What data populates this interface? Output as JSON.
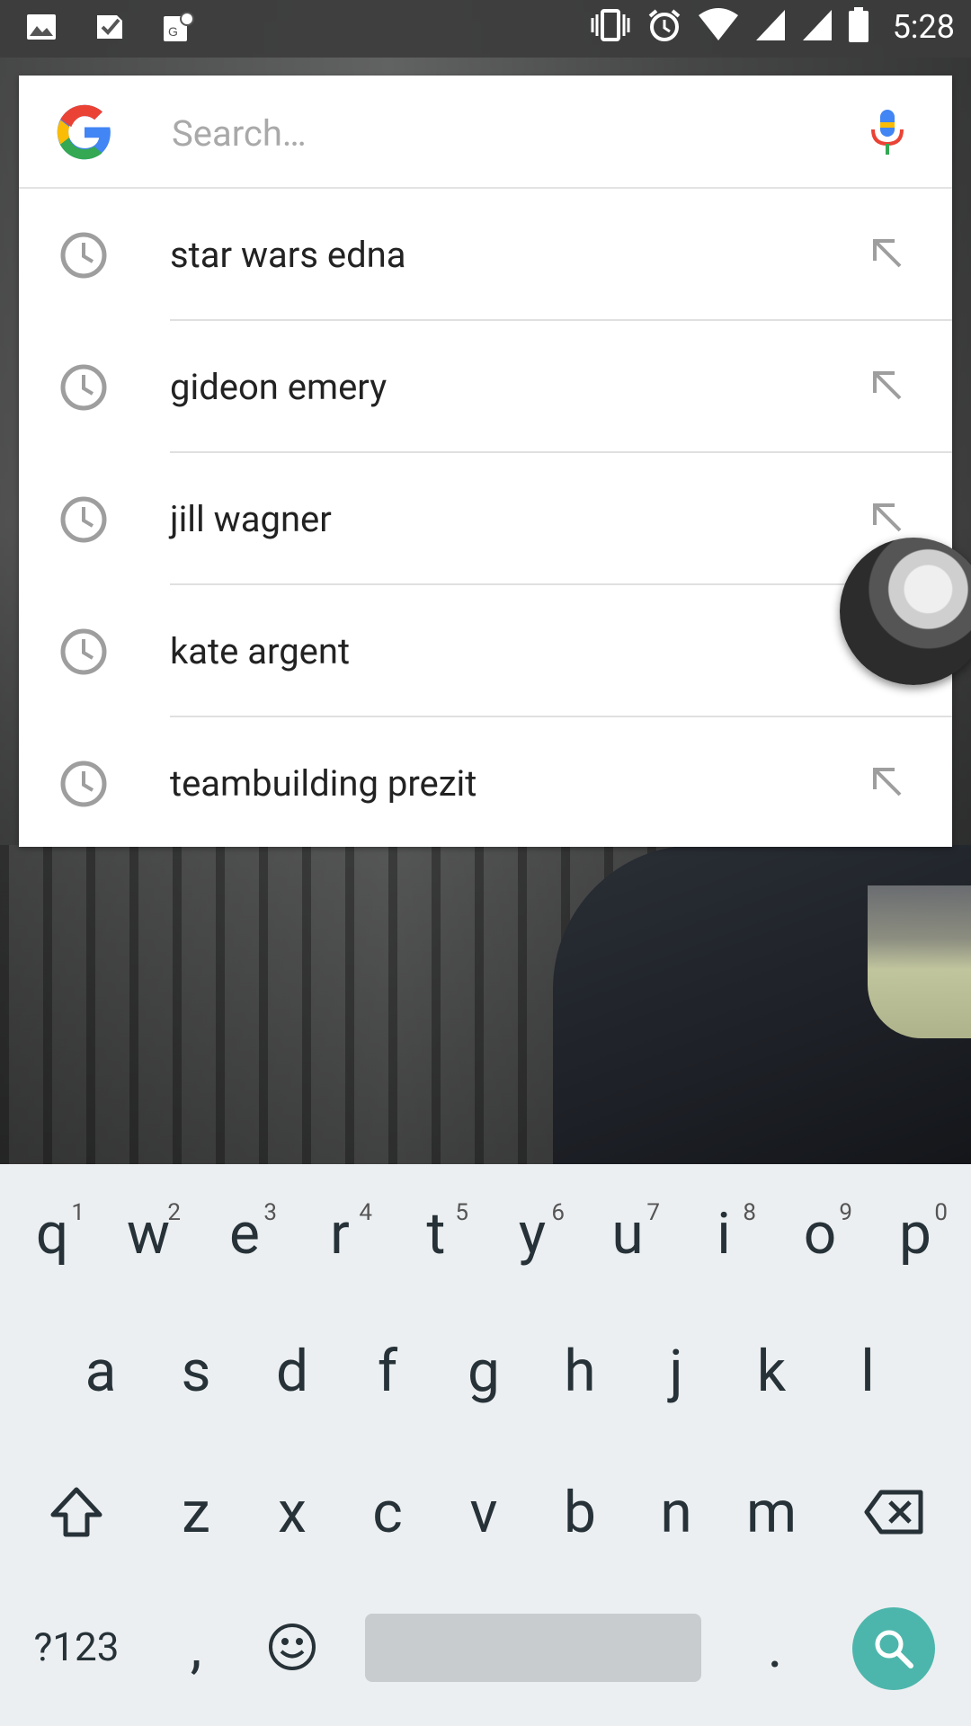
{
  "status_bar": {
    "time": "5:28",
    "left_icons": [
      "image-icon",
      "check-icon",
      "maps-icon"
    ],
    "right_icons": [
      "vibrate-icon",
      "alarm-icon",
      "wifi-icon",
      "signal-icon",
      "signal2-icon",
      "battery-icon"
    ]
  },
  "search": {
    "placeholder": "Search…",
    "value": ""
  },
  "suggestions": [
    {
      "label": "star wars edna"
    },
    {
      "label": "gideon emery"
    },
    {
      "label": "jill wagner"
    },
    {
      "label": "kate argent"
    },
    {
      "label": "teambuilding prezit"
    }
  ],
  "keyboard": {
    "row1": [
      {
        "key": "q",
        "hint": "1"
      },
      {
        "key": "w",
        "hint": "2"
      },
      {
        "key": "e",
        "hint": "3"
      },
      {
        "key": "r",
        "hint": "4"
      },
      {
        "key": "t",
        "hint": "5"
      },
      {
        "key": "y",
        "hint": "6"
      },
      {
        "key": "u",
        "hint": "7"
      },
      {
        "key": "i",
        "hint": "8"
      },
      {
        "key": "o",
        "hint": "9"
      },
      {
        "key": "p",
        "hint": "0"
      }
    ],
    "row2": [
      "a",
      "s",
      "d",
      "f",
      "g",
      "h",
      "j",
      "k",
      "l"
    ],
    "row3": [
      "z",
      "x",
      "c",
      "v",
      "b",
      "n",
      "m"
    ],
    "symbols_label": "?123",
    "comma": ",",
    "period": "."
  },
  "colors": {
    "keyboard_bg": "#eceff1",
    "go_key": "#4db6ac",
    "google_blue": "#4285f4",
    "google_red": "#ea4335",
    "google_yellow": "#fbbc05",
    "google_green": "#34a853"
  }
}
